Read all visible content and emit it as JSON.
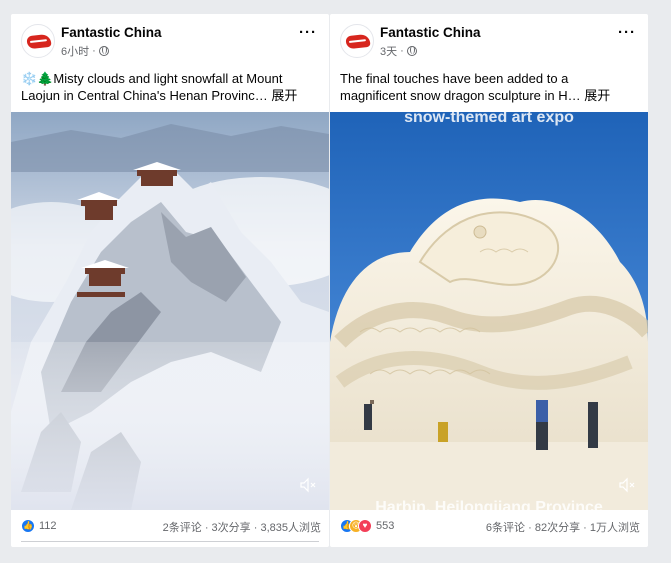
{
  "posts": [
    {
      "page_name": "Fantastic China",
      "time": "6小时",
      "text_line1": "❄️🌲Misty clouds and light snowfall at Mount",
      "text_line2": "Laojun in Central China's Henan Provinc…",
      "see_more": "展开",
      "reaction_count": "112",
      "comments": "2条评论",
      "shares": "3次分享",
      "views": "3,835人浏览",
      "reaction_icons": [
        "like"
      ]
    },
    {
      "page_name": "Fantastic China",
      "time": "3天",
      "text_line1": "The final touches have been added to a",
      "text_line2": "magnificent snow dragon sculpture in H…",
      "see_more": "展开",
      "reaction_count": "553",
      "comments": "6条评论",
      "shares": "82次分享",
      "views": "1万人浏览",
      "video_caption_top": "snow-themed art expo",
      "video_caption_bottom": "Harbin, Heilongjiang Province",
      "reaction_icons": [
        "like",
        "wow",
        "love"
      ]
    }
  ],
  "separator": "·",
  "more_label": "···",
  "colors": {
    "like": "#1877f2",
    "wow": "#f7b125",
    "love": "#f33e58",
    "brand": "#d7261e"
  }
}
